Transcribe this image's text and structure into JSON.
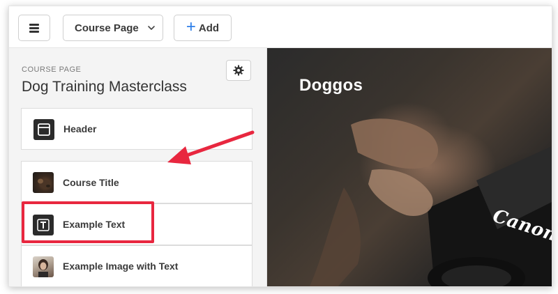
{
  "toolbar": {
    "menu_icon": "hamburger-icon",
    "page_select_label": "Course Page",
    "add_label": "Add"
  },
  "sidebar": {
    "eyebrow": "COURSE PAGE",
    "title": "Dog Training Masterclass",
    "settings_icon": "gear-icon",
    "sections": [
      {
        "label": "Header",
        "icon": "layout-header-icon"
      },
      {
        "label": "Course Title",
        "icon": "dog-photo-thumbnail",
        "highlighted": true
      },
      {
        "label": "Example Text",
        "icon": "text-T-icon"
      },
      {
        "label": "Example Image with Text",
        "icon": "portrait-photo-thumbnail"
      }
    ]
  },
  "preview": {
    "title": "Doggos",
    "camera_brand": "Canon"
  },
  "colors": {
    "accent_blue": "#2d7ee8",
    "highlight_red": "#e8273f"
  }
}
